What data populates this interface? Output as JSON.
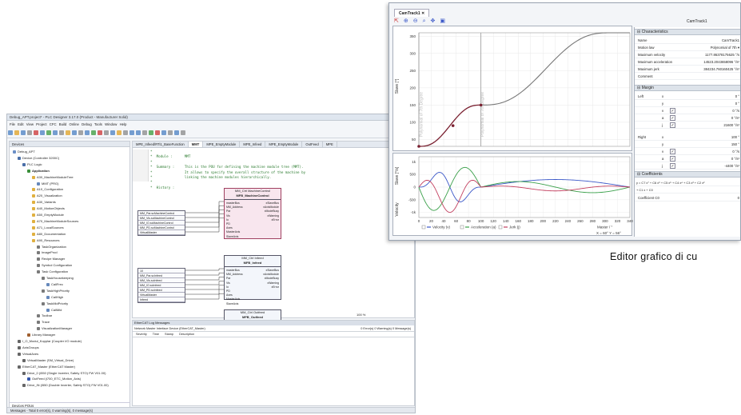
{
  "ide": {
    "title": "Debug_APT.project* - PLC Designer 3.17.0 (Product - Manufacturer Solid)",
    "menu": "File  Edit  View  Project  CFC  Build  Online  Debug  Tools  Window  Help",
    "devices_title": "Devices",
    "tree": [
      {
        "label": "Debug_APT",
        "depth": 0,
        "color": "#6b8fc7"
      },
      {
        "label": "Device (Controller 3200C)",
        "depth": 1,
        "color": "#4a6fa8"
      },
      {
        "label": "PLC Logic",
        "depth": 2,
        "color": "#4a6fa8"
      },
      {
        "label": "Application",
        "depth": 3,
        "color": "#3a8f3a",
        "bold": true
      },
      {
        "label": "A30_MachineModuleTree",
        "depth": 4,
        "color": "#e0b040"
      },
      {
        "label": "MMT (PRG)",
        "depth": 5,
        "color": "#6688bb"
      },
      {
        "label": "A10_Configuration",
        "depth": 4,
        "color": "#e0b040"
      },
      {
        "label": "A20_Visualization",
        "depth": 4,
        "color": "#e0b040"
      },
      {
        "label": "A30_Variants",
        "depth": 4,
        "color": "#e0b040"
      },
      {
        "label": "A40_MotionObjects",
        "depth": 4,
        "color": "#e0b040"
      },
      {
        "label": "A50_EmptyModule",
        "depth": 4,
        "color": "#e0b040"
      },
      {
        "label": "A70_MachineModuleSources",
        "depth": 4,
        "color": "#e0b040"
      },
      {
        "label": "A71_LocalSources",
        "depth": 4,
        "color": "#e0b040"
      },
      {
        "label": "A80_Documentation",
        "depth": 4,
        "color": "#e0b040"
      },
      {
        "label": "A90_Resources",
        "depth": 4,
        "color": "#e0b040"
      },
      {
        "label": "TaskOrganization",
        "depth": 5,
        "color": "#7a7a7a"
      },
      {
        "label": "ImageProd",
        "depth": 5,
        "color": "#7a7a7a"
      },
      {
        "label": "Recipe Manager",
        "depth": 5,
        "color": "#7a7a7a"
      },
      {
        "label": "Symbol Configuration",
        "depth": 5,
        "color": "#7a7a7a"
      },
      {
        "label": "Task Configuration",
        "depth": 5,
        "color": "#7a7a7a"
      },
      {
        "label": "TaskHousekeeping",
        "depth": 6,
        "color": "#7a7a7a"
      },
      {
        "label": "CallFrec",
        "depth": 7,
        "color": "#6688bb"
      },
      {
        "label": "TaskHighPriority",
        "depth": 6,
        "color": "#7a7a7a"
      },
      {
        "label": "CallHigh",
        "depth": 7,
        "color": "#6688bb"
      },
      {
        "label": "TaskMidPriority",
        "depth": 6,
        "color": "#7a7a7a"
      },
      {
        "label": "CallMid",
        "depth": 7,
        "color": "#6688bb"
      },
      {
        "label": "Toolbar",
        "depth": 5,
        "color": "#7a7a7a"
      },
      {
        "label": "Trace",
        "depth": 5,
        "color": "#7a7a7a"
      },
      {
        "label": "VisualizationManager",
        "depth": 5,
        "color": "#7a7a7a"
      },
      {
        "label": "Library Manager",
        "depth": 3,
        "color": "#a06030"
      },
      {
        "label": "I_O_Modul_Kopplar (Coupler I/O module)",
        "depth": 1,
        "color": "#666"
      },
      {
        "label": "AxisGroups",
        "depth": 1,
        "color": "#666"
      },
      {
        "label": "VirtualAxes",
        "depth": 1,
        "color": "#666"
      },
      {
        "label": "VirtualMaster (SM_Virtual_Drive)",
        "depth": 2,
        "color": "#666"
      },
      {
        "label": "EtherCAT_Master (EtherCAT Master)",
        "depth": 1,
        "color": "#666"
      },
      {
        "label": "Drive_0 (i550 (Single Inverter, Safety STO) FW V01.00)",
        "depth": 2,
        "color": "#666"
      },
      {
        "label": "OutFeed (i700_ETC_Motion_Axis)",
        "depth": 3,
        "color": "#3355aa"
      },
      {
        "label": "Drive_IN (i550 (Double Inverter, Safety STO) FW V01.00)",
        "depth": 2,
        "color": "#666"
      }
    ],
    "device_tabs": "Devices  POUs",
    "status": "Messages - Total 0 error(s), 0 warning(s), 0 message(s)",
    "editor_tabs": [
      "MPE_Infeed/RTi1_BaseFunction",
      "MMT",
      "MPE_EmptyModule",
      "MPE_Infeed",
      "MPE_EmptyModule",
      "OutFeed",
      "MPE"
    ],
    "code": "*\n*  Module :      MMT\n*\n*  Summary :     This is the POU for defining the machine module tree (MMT).\n*                It allows to specify the overall structure of the machine by\n*                linking the machine modules hierarchically.\n*\n*  History :",
    "fb1": {
      "instance": "MM_Ctrl MachineControl",
      "type": "MFB_MachineControl",
      "inputs": [
        "masterBus",
        "MM_Address",
        "Par",
        "Vis",
        "Io",
        "PD",
        "Axes",
        "MasterAxis",
        "SlaveAxis"
      ],
      "outputs": [
        "xSlaveBus",
        "xAxisModule",
        "xModeBusy",
        "xWarning",
        "xError"
      ]
    },
    "fb1_vars": [
      "MM_Par.scMachineControl",
      "MM_Vis.scMachineControl",
      "MM_IO.scMachineControl",
      "MM_PD.scMachineControl",
      "VirtualMaster"
    ],
    "fb2": {
      "instance": "MM_Ctrl Infeed",
      "type": "MFB_Infeed",
      "inputs": [
        "masterBus",
        "MM_Address",
        "Par",
        "Vis",
        "Io",
        "PD",
        "Axes",
        "MasterAxis",
        "SlaveAxis"
      ],
      "outputs": [
        "xSlaveBus",
        "xAxisModule",
        "xModeBusy",
        "xWarning",
        "xError"
      ]
    },
    "fb2_vars": [
      "10",
      "MM_Par.scInfeed",
      "MM_Vis.scInfeed",
      "MM_IO.scInfeed",
      "MM_PD.scInfeed",
      "VirtualMaster",
      "Infeed"
    ],
    "fb3": {
      "instance": "MM_Ctrl Outfeed",
      "type": "MFB_Outfeed",
      "inputs": [
        "masterBus",
        "MM_Address",
        "Par",
        "Vis",
        "Io",
        "PD",
        "Axes",
        "MasterAxis",
        "SlaveAxis"
      ],
      "outputs": [
        "xSlaveBus",
        "xAxisModule",
        "xModeBusy",
        "xWarning",
        "xError"
      ]
    },
    "fb3_vars": [
      "11",
      "MM_Par.scOutfeed",
      "MM_Vis.scOutfeed",
      "MM_IO.scOutfeed",
      "MM_PD.scOutfeed",
      "VirtualMaster",
      "Outfeed"
    ],
    "editor_footer": "100 %",
    "msgs_title": "EtherCAT Log Messages",
    "msgs_source": "Network Master Interface  Device (EtherCAT_Master)",
    "msgs_counts": "0 Error(s)   0 Warning(s)   0 Message(s)",
    "msgs_cols": "Severity  Time Stamp  Description"
  },
  "cam": {
    "tab": "CamTrack1",
    "name_top": "CamTrack1",
    "plot1_ylabel": "Slave [°]",
    "plot2_ylabel": "Slave [°/s]",
    "plot2_side": "Velocity",
    "plot1_annot_left": "Polynomial of 7th Degree",
    "plot1_annot_right": "Polynomial of 7th Degree",
    "y1_ticks": [
      "350",
      "300",
      "250",
      "200",
      "150",
      "100",
      "50"
    ],
    "y2_ticks": [
      "1k",
      "500",
      "0",
      "-500",
      "-1k"
    ],
    "x_ticks": [
      "0",
      "20",
      "40",
      "60",
      "80",
      "100",
      "120",
      "140",
      "160",
      "180",
      "200",
      "220",
      "240",
      "260",
      "280",
      "300",
      "320",
      "340"
    ],
    "legend": [
      "Velocity (v)",
      "Acceleration (a)",
      "Jerk (j)"
    ],
    "xlabel": "Master / °",
    "coords": "X = 60°   Y = 56°",
    "characteristics_title": "Characteristics",
    "characteristics": [
      {
        "k": "Name",
        "v": "CamTrack1"
      },
      {
        "k": "Motion law",
        "v": "Polynomial of 7th  ▾"
      },
      {
        "k": "Maximum velocity",
        "v": "1177.86378175625  °/s"
      },
      {
        "k": "Maximum acceleration",
        "v": "14523.2043658096  °/s²"
      },
      {
        "k": "Maximum jerk",
        "v": "384234.760160425  °/s³"
      },
      {
        "k": "Comment",
        "v": ""
      }
    ],
    "margin_title": "Margin",
    "margin_left_label": "Left",
    "margin_left": [
      {
        "k": "x",
        "v": "0  °",
        "chk": false
      },
      {
        "k": "y",
        "v": "0  °",
        "chk": false
      },
      {
        "k": "v",
        "v": "0  °/s",
        "chk": true
      },
      {
        "k": "a",
        "v": "0  °/s²",
        "chk": true
      },
      {
        "k": "j",
        "v": "21600  °/s³",
        "chk": true
      }
    ],
    "margin_right_label": "Right",
    "margin_right": [
      {
        "k": "x",
        "v": "100  °",
        "chk": false
      },
      {
        "k": "y",
        "v": "150  °",
        "chk": false
      },
      {
        "k": "v",
        "v": "0  °/s",
        "chk": true
      },
      {
        "k": "a",
        "v": "0  °/s²",
        "chk": true
      },
      {
        "k": "j",
        "v": "-4400  °/s³",
        "chk": true
      }
    ],
    "coefficients_title": "Coefficients",
    "coeff_formula": "y = C7 x⁷ + C6 x⁶ + C5 x⁵ + C4 x⁴ + C3 x³ + C2 x²",
    "coeff_formula2": "+ C1 x  + C0",
    "coeff_row": {
      "k": "Coefficient C0",
      "v": "0"
    },
    "colors": {
      "velocity": "#3a57c8",
      "acceleration": "#3aa04a",
      "jerk": "#c34060",
      "curve": "#777777"
    }
  },
  "caption": "Editor grafico di cu"
}
